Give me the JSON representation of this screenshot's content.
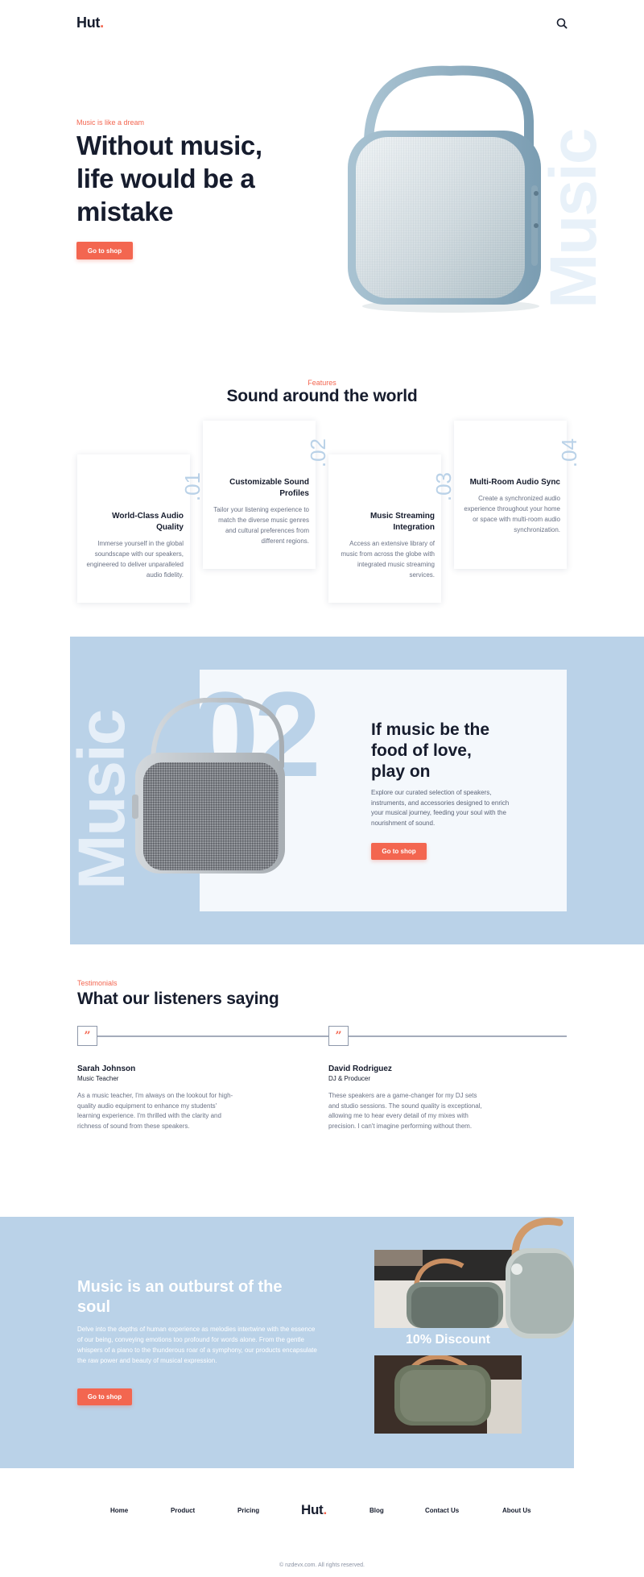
{
  "header": {
    "logo_text": "Hut",
    "logo_dot": ".",
    "search_icon": "search-icon"
  },
  "hero": {
    "eyebrow": "Music is like a dream",
    "title_lines": [
      "Without music,",
      "life would be a",
      "mistake"
    ],
    "cta": "Go to shop",
    "watermark": "Music"
  },
  "features": {
    "eyebrow": "Features",
    "title": "Sound around the world",
    "cards": [
      {
        "num": ".01",
        "title": "World-Class Audio Quality",
        "body": "Immerse yourself in the global soundscape with our speakers, engineered to deliver unparalleled audio fidelity."
      },
      {
        "num": ".02",
        "title": "Customizable Sound Profiles",
        "body": "Tailor your listening experience to match the diverse music genres and cultural preferences from different regions."
      },
      {
        "num": ".03",
        "title": "Music Streaming Integration",
        "body": "Access an extensive library of music from across the globe with integrated music streaming services."
      },
      {
        "num": ".04",
        "title": "Multi-Room Audio Sync",
        "body": "Create a synchronized audio experience throughout your home or space with multi-room audio synchronization."
      }
    ]
  },
  "promo": {
    "watermark": "Music",
    "big_number": "02",
    "title_lines": [
      "If music be the",
      "food of love,",
      "play on"
    ],
    "body": "Explore our curated selection of speakers, instruments, and accessories designed to enrich your musical journey, feeding your soul with the nourishment of sound.",
    "cta": "Go to shop"
  },
  "testimonials": {
    "eyebrow": "Testimonials",
    "title": "What our listeners saying",
    "quote_mark": "”",
    "items": [
      {
        "name": "Sarah Johnson",
        "role": "Music Teacher",
        "text": "As a music teacher, I'm always on the lookout for high-quality audio equipment to enhance my students' learning experience. I'm thrilled with the clarity and richness of sound from these speakers."
      },
      {
        "name": "David Rodriguez",
        "role": "DJ & Producer",
        "text": "These speakers are a game-changer for my DJ sets and studio sessions. The sound quality is exceptional, allowing me to hear every detail of my mixes with precision. I can't imagine performing without them."
      }
    ]
  },
  "outburst": {
    "title_lines": [
      "Music is an outburst of the",
      "soul"
    ],
    "body": "Delve into the depths of human experience as melodies intertwine with the essence of our being, conveying emotions too profound for words alone. From the gentle whispers of a piano to the thunderous roar of a symphony, our products encapsulate the raw power and beauty of musical expression.",
    "cta": "Go to shop",
    "discount": "10% Discount"
  },
  "footer": {
    "links_left": [
      "Home",
      "Product",
      "Pricing"
    ],
    "logo_text": "Hut",
    "logo_dot": ".",
    "links_right": [
      "Blog",
      "Contact Us",
      "About Us"
    ],
    "copyright": "© nzdevx.com. All rights reserved."
  },
  "colors": {
    "accent": "#f36650",
    "dark": "#161c2d",
    "light_blue": "#bad2e8",
    "pale": "#f4f8fc"
  }
}
